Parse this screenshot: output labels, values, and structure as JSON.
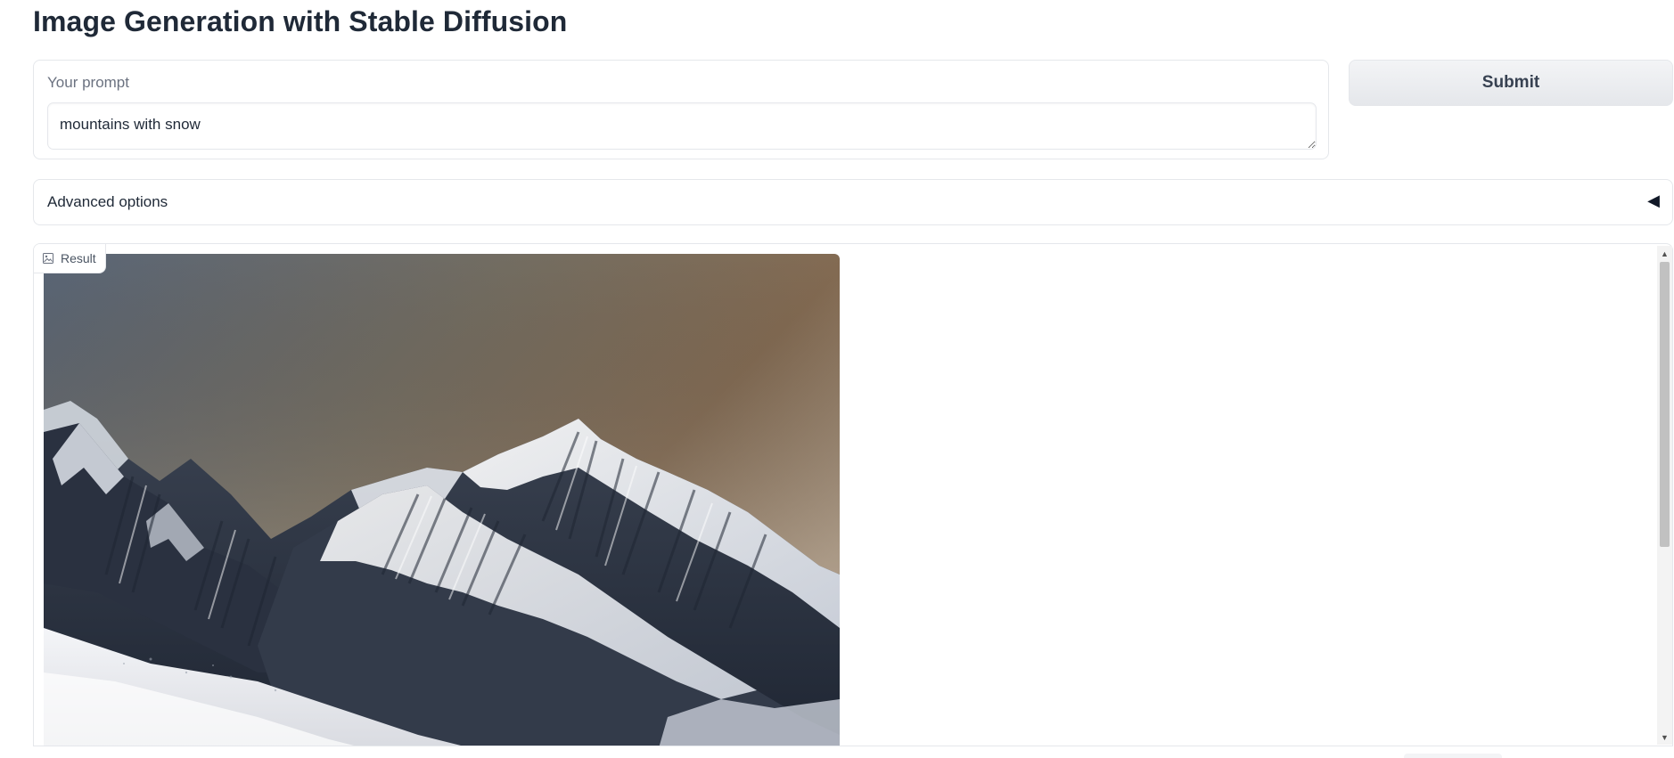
{
  "app": {
    "title": "Image Generation with Stable Diffusion"
  },
  "prompt": {
    "label": "Your prompt",
    "value": "mountains with snow"
  },
  "submit": {
    "label": "Submit"
  },
  "advanced": {
    "label": "Advanced options",
    "arrow": "◀"
  },
  "result": {
    "label": "Result",
    "icon": "image-icon"
  },
  "scrollbar": {
    "up": "▲",
    "down": "▼"
  },
  "colors": {
    "border": "#e5e7eb",
    "text": "#1f2937",
    "muted": "#6b7280",
    "button_bg": "#e5e7eb"
  }
}
